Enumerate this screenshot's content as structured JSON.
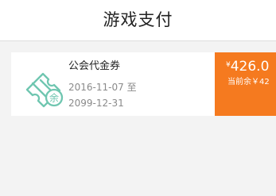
{
  "header": {
    "title": "游戏支付"
  },
  "voucher": {
    "icon_name": "ticket-balance-icon",
    "icon_badge": "余",
    "name": "公会代金券",
    "validity_start": "2016-11-07",
    "validity_separator": "至",
    "validity_end": "2099-12-31",
    "currency_symbol": "¥",
    "amount": "426.0",
    "balance_label": "当前余￥42",
    "accent_color": "#f57a1f",
    "icon_color": "#6fc6b0"
  }
}
